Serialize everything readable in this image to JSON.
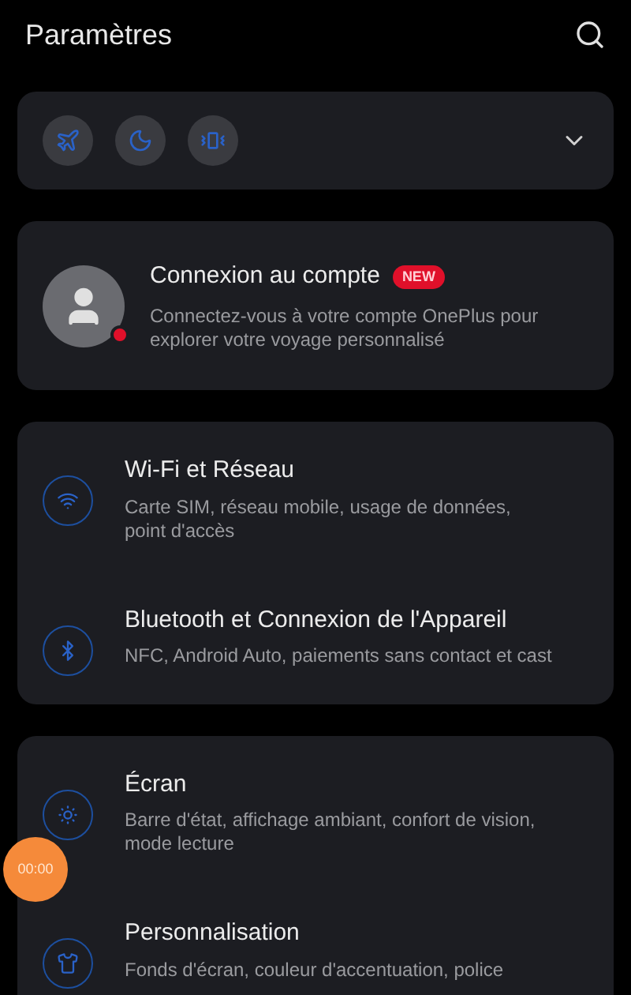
{
  "header": {
    "title": "Paramètres"
  },
  "quick_toggles": {
    "expanded": false
  },
  "account": {
    "title": "Connexion au compte",
    "badge": "NEW",
    "description": "Connectez-vous à votre compte OnePlus pour explorer votre voyage personnalisé"
  },
  "groups": [
    {
      "items": [
        {
          "title": "Wi-Fi et Réseau",
          "description": "Carte SIM, réseau mobile, usage de données, point d'accès"
        },
        {
          "title": "Bluetooth et Connexion de l'Appareil",
          "description": "NFC, Android Auto, paiements sans contact et cast"
        }
      ]
    },
    {
      "items": [
        {
          "title": "Écran",
          "description": "Barre d'état, affichage ambiant, confort de vision, mode lecture"
        },
        {
          "title": "Personnalisation",
          "description": "Fonds d'écran, couleur d'accentuation, police"
        }
      ]
    }
  ],
  "floating_timer": {
    "label": "00:00"
  }
}
